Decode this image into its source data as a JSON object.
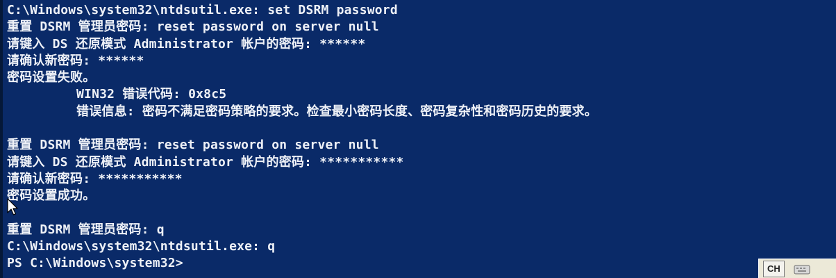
{
  "console": {
    "lines": [
      "C:\\Windows\\system32\\ntdsutil.exe: set DSRM password",
      "重置 DSRM 管理员密码: reset password on server null",
      "请键入 DS 还原模式 Administrator 帐户的密码: ******",
      "请确认新密码: ******",
      "密码设置失败。",
      "WIN32 错误代码: 0x8c5",
      "错误信息: 密码不满足密码策略的要求。检查最小密码长度、密码复杂性和密码历史的要求。",
      "",
      "重置 DSRM 管理员密码: reset password on server null",
      "请键入 DS 还原模式 Administrator 帐户的密码: ***********",
      "请确认新密码: ***********",
      "密码设置成功。",
      "",
      "重置 DSRM 管理员密码: q",
      "C:\\Windows\\system32\\ntdsutil.exe: q",
      "PS C:\\Windows\\system32>"
    ]
  },
  "ime_bar": {
    "language_label": "CH",
    "keyboard_icon": "keyboard-icon"
  },
  "cursor_icon": "mouse-pointer-icon",
  "colors": {
    "background": "#0a2a68",
    "text": "#eef1f7"
  }
}
